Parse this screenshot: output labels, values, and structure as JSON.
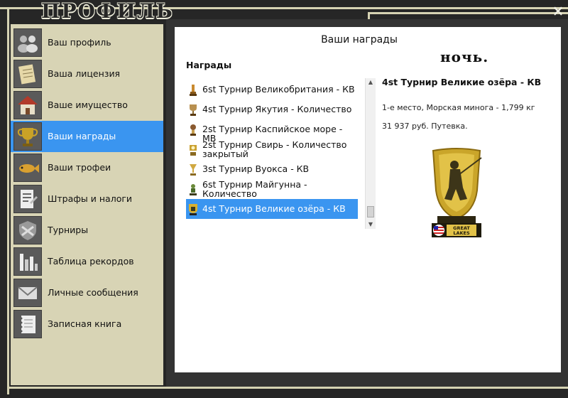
{
  "window": {
    "title": "ПРОФИЛЬ",
    "close_label": "×"
  },
  "sidebar": {
    "items": [
      {
        "label": "Ваш профиль",
        "icon": "users-icon"
      },
      {
        "label": "Ваша лицензия",
        "icon": "license-icon"
      },
      {
        "label": "Ваше имущество",
        "icon": "house-icon"
      },
      {
        "label": "Ваши награды",
        "icon": "trophy-icon",
        "active": true
      },
      {
        "label": "Ваши трофеи",
        "icon": "fish-icon"
      },
      {
        "label": "Штрафы и налоги",
        "icon": "document-icon"
      },
      {
        "label": "Турниры",
        "icon": "shield-icon"
      },
      {
        "label": "Таблица рекордов",
        "icon": "bar-chart-icon"
      },
      {
        "label": "Личные сообщения",
        "icon": "envelope-icon"
      },
      {
        "label": "Записная книга",
        "icon": "notebook-icon"
      }
    ]
  },
  "main": {
    "title": "Ваши награды",
    "nickname": "ночь.",
    "awards_heading": "Награды",
    "awards": [
      {
        "label": "6st Турнир Великобритания - КВ"
      },
      {
        "label": "4st Турнир Якутия - Количество"
      },
      {
        "label": "2st Турнир Каспийское море - МВ"
      },
      {
        "label": "2st Турнир Свирь - Количество закрытый"
      },
      {
        "label": "3st Турнир Вуокса - КВ"
      },
      {
        "label": "6st Турнир Майгунна - Количество"
      },
      {
        "label": "4st Турнир Великие озёра - КВ",
        "selected": true
      }
    ],
    "detail": {
      "title": "4st Турнир Великие озёра - КВ",
      "line1": "1-е место, Морская минога - 1,799 кг",
      "line2": "31 937 руб. Путевка.",
      "badge_top": "GREAT",
      "badge_bottom": "LAKES"
    }
  },
  "colors": {
    "accent": "#3a95f0",
    "sidebar_bg": "#d8d4b5",
    "frame": "#262626"
  }
}
